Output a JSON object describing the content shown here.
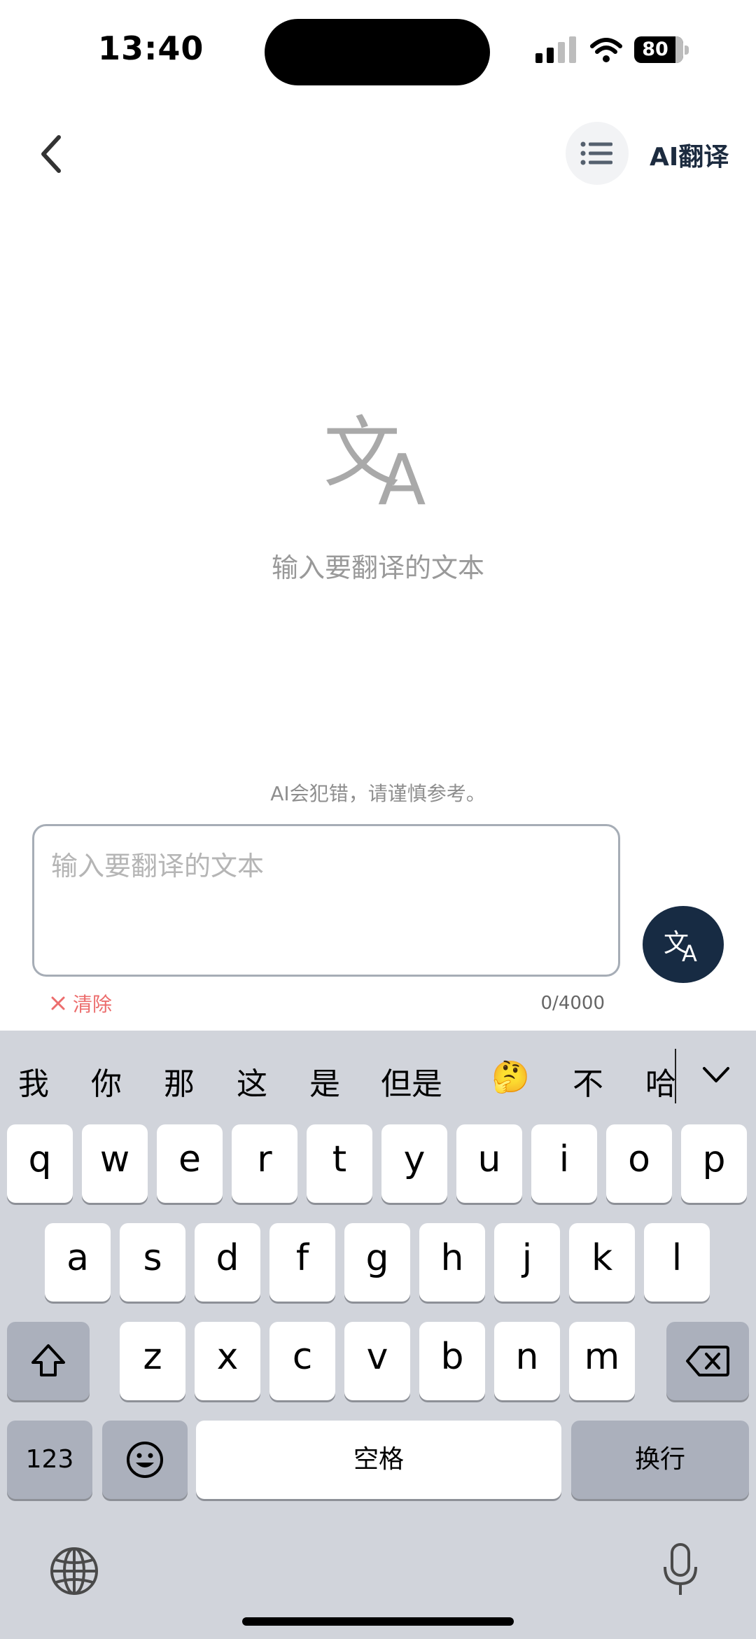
{
  "status_bar": {
    "time": "13:40",
    "battery": "80"
  },
  "nav": {
    "title": "AI翻译",
    "back_icon": "chevron-left-icon",
    "menu_icon": "list-icon"
  },
  "empty_state": {
    "icon": "translate-icon",
    "hint": "输入要翻译的文本"
  },
  "disclaimer": "AI会犯错，请谨慎参考。",
  "input": {
    "placeholder": "输入要翻译的文本",
    "value": ""
  },
  "clear": {
    "icon": "close-icon",
    "label": "清除"
  },
  "counter": "0/4000",
  "translate_button": {
    "icon": "translate-icon"
  },
  "keyboard": {
    "candidates": [
      "我",
      "你",
      "那",
      "这",
      "是",
      "但是",
      "🤔",
      "不",
      "哈"
    ],
    "row1": [
      "q",
      "w",
      "e",
      "r",
      "t",
      "y",
      "u",
      "i",
      "o",
      "p"
    ],
    "row2": [
      "a",
      "s",
      "d",
      "f",
      "g",
      "h",
      "j",
      "k",
      "l"
    ],
    "row3": [
      "z",
      "x",
      "c",
      "v",
      "b",
      "n",
      "m"
    ],
    "numbers_label": "123",
    "space_label": "空格",
    "return_label": "换行",
    "colors": {
      "background": "#d1d4db",
      "key": "#ffffff",
      "dark_key": "#abb0bc"
    }
  },
  "colors": {
    "accent": "#172b43",
    "clear": "#ec6d6d",
    "hint": "#999999"
  }
}
